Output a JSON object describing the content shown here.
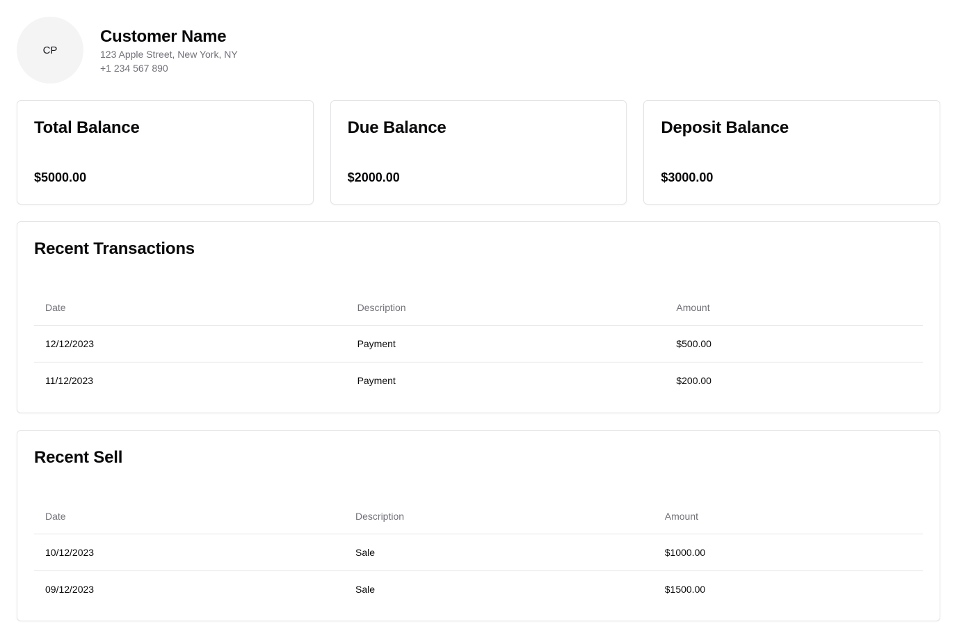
{
  "customer": {
    "initials": "CP",
    "name": "Customer Name",
    "address": "123 Apple Street, New York, NY",
    "phone": "+1 234 567 890"
  },
  "balances": [
    {
      "title": "Total Balance",
      "value": "$5000.00"
    },
    {
      "title": "Due Balance",
      "value": "$2000.00"
    },
    {
      "title": "Deposit Balance",
      "value": "$3000.00"
    }
  ],
  "transactions": {
    "title": "Recent Transactions",
    "headers": [
      "Date",
      "Description",
      "Amount"
    ],
    "rows": [
      {
        "date": "12/12/2023",
        "description": "Payment",
        "amount": "$500.00"
      },
      {
        "date": "11/12/2023",
        "description": "Payment",
        "amount": "$200.00"
      }
    ]
  },
  "sells": {
    "title": "Recent Sell",
    "headers": [
      "Date",
      "Description",
      "Amount"
    ],
    "rows": [
      {
        "date": "10/12/2023",
        "description": "Sale",
        "amount": "$1000.00"
      },
      {
        "date": "09/12/2023",
        "description": "Sale",
        "amount": "$1500.00"
      }
    ]
  },
  "colors": {
    "border": "#e4e4e7",
    "muted_text": "#71717a",
    "avatar_bg": "#f4f4f5",
    "text": "#09090b"
  }
}
